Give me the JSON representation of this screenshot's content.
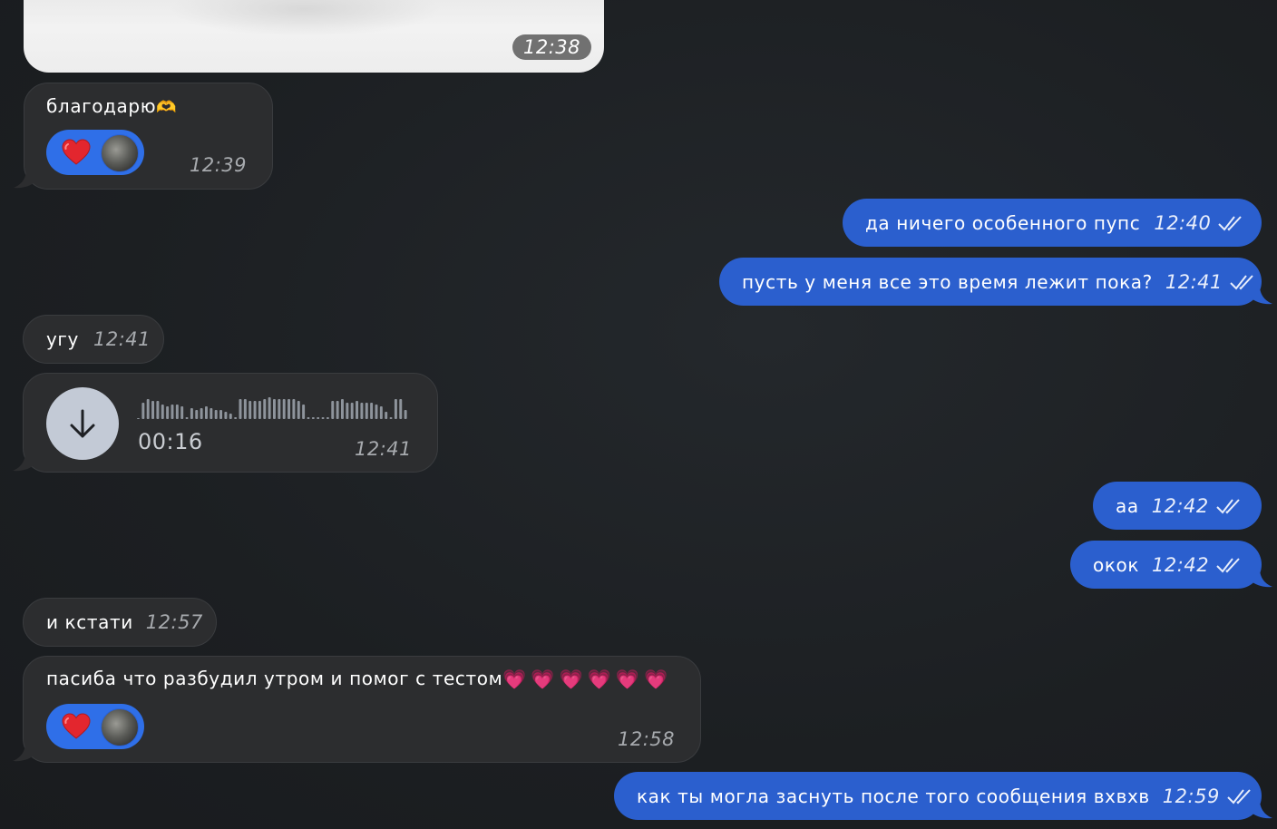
{
  "colors": {
    "background": "#1c1f22",
    "incoming_bubble": "#2c2d2f",
    "outgoing_bubble": "#2b5fce",
    "reaction_pill": "#2f6fe8"
  },
  "messages": {
    "photo": {
      "time": "12:38"
    },
    "m1": {
      "text": "благодарю",
      "emoji": "🫶",
      "reaction": "❤️",
      "time": "12:39"
    },
    "m2": {
      "text": "да ничего особенного пупс",
      "time": "12:40"
    },
    "m3": {
      "text": "пусть у меня все это время лежит пока?",
      "time": "12:41"
    },
    "m4": {
      "text": "угу",
      "time": "12:41"
    },
    "voice": {
      "duration": "00:16",
      "time": "12:41",
      "icon": "download-arrow-icon"
    },
    "m5": {
      "text": "аа",
      "time": "12:42"
    },
    "m6": {
      "text": "окок",
      "time": "12:42"
    },
    "m7": {
      "text": "и кстати",
      "time": "12:57"
    },
    "m8": {
      "text": "пасиба что разбудил утром и помог с тестом",
      "emoji": "💗💗💗💗💗💗",
      "reaction": "❤️",
      "time": "12:58"
    },
    "m9": {
      "text": "как ты могла заснуть после того сообщения вхвхв",
      "time": "12:59"
    }
  }
}
